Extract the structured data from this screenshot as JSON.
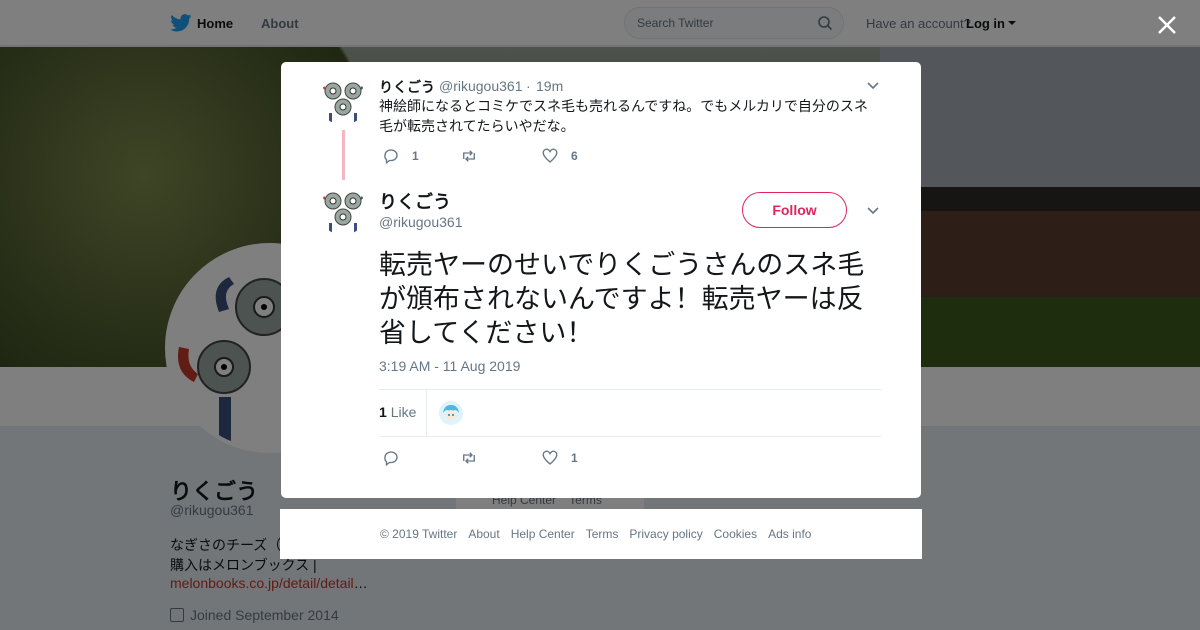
{
  "topbar": {
    "home_label": "Home",
    "about_label": "About",
    "search_placeholder": "Search Twitter",
    "have_account": "Have an account?",
    "login_label": "Log in"
  },
  "profile": {
    "name": "りくごう",
    "handle": "@rikugou361",
    "bio_line1": "なぎさのチーズ（",
    "bio_line2": "購入はメロンブックス |",
    "link": "melonbooks.co.jp/detail/detail",
    "link_suffix": "…",
    "joined": "Joined September 2014",
    "sidebar_links": "Help Center    Terms"
  },
  "parent_tweet": {
    "name": "りくごう",
    "handle": "@rikugou361",
    "separator": "·",
    "time": "19m",
    "text": "神絵師になるとコミケでスネ毛も売れるんですね。でもメルカリで自分のスネ毛が転売されてたらいやだな。",
    "reply_count": "1",
    "retweet_count": "",
    "like_count": "6"
  },
  "main_tweet": {
    "name": "りくごう",
    "handle": "@rikugou361",
    "follow_label": "Follow",
    "text": "転売ヤーのせいでりくごうさんのスネ毛が頒布されないんですよ！転売ヤーは反省してください！",
    "date": "3:19 AM - 11 Aug 2019",
    "likes_count": "1",
    "likes_label": "Like",
    "reply_count": "",
    "retweet_count": "",
    "like_count": "1"
  },
  "footer": {
    "copyright": "© 2019 Twitter",
    "links": [
      "About",
      "Help Center",
      "Terms",
      "Privacy policy",
      "Cookies",
      "Ads info"
    ]
  },
  "colors": {
    "accent_red": "#e0245e",
    "twitter_blue": "#1da1f2",
    "thread_line": "#f4b6bf"
  },
  "icons": [
    "twitter-bird-icon",
    "search-icon",
    "close-icon",
    "chevron-down-icon",
    "reply-icon",
    "retweet-icon",
    "heart-icon",
    "calendar-icon"
  ]
}
